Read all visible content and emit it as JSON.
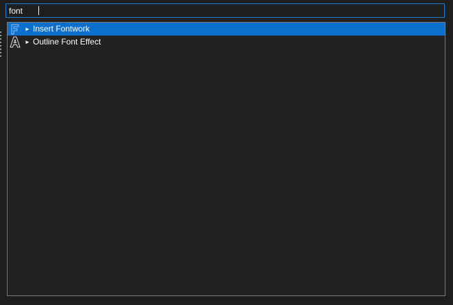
{
  "search": {
    "value": "font"
  },
  "results": [
    {
      "label": "Insert Fontwork",
      "icon": "fontwork-icon",
      "selected": true
    },
    {
      "label": "Outline Font Effect",
      "icon": "outline-font-icon",
      "selected": false
    }
  ],
  "colors": {
    "selection": "#0b6fce",
    "focus_border": "#1e7bd0",
    "list_background": "#222222",
    "background": "#1e1e1e"
  }
}
